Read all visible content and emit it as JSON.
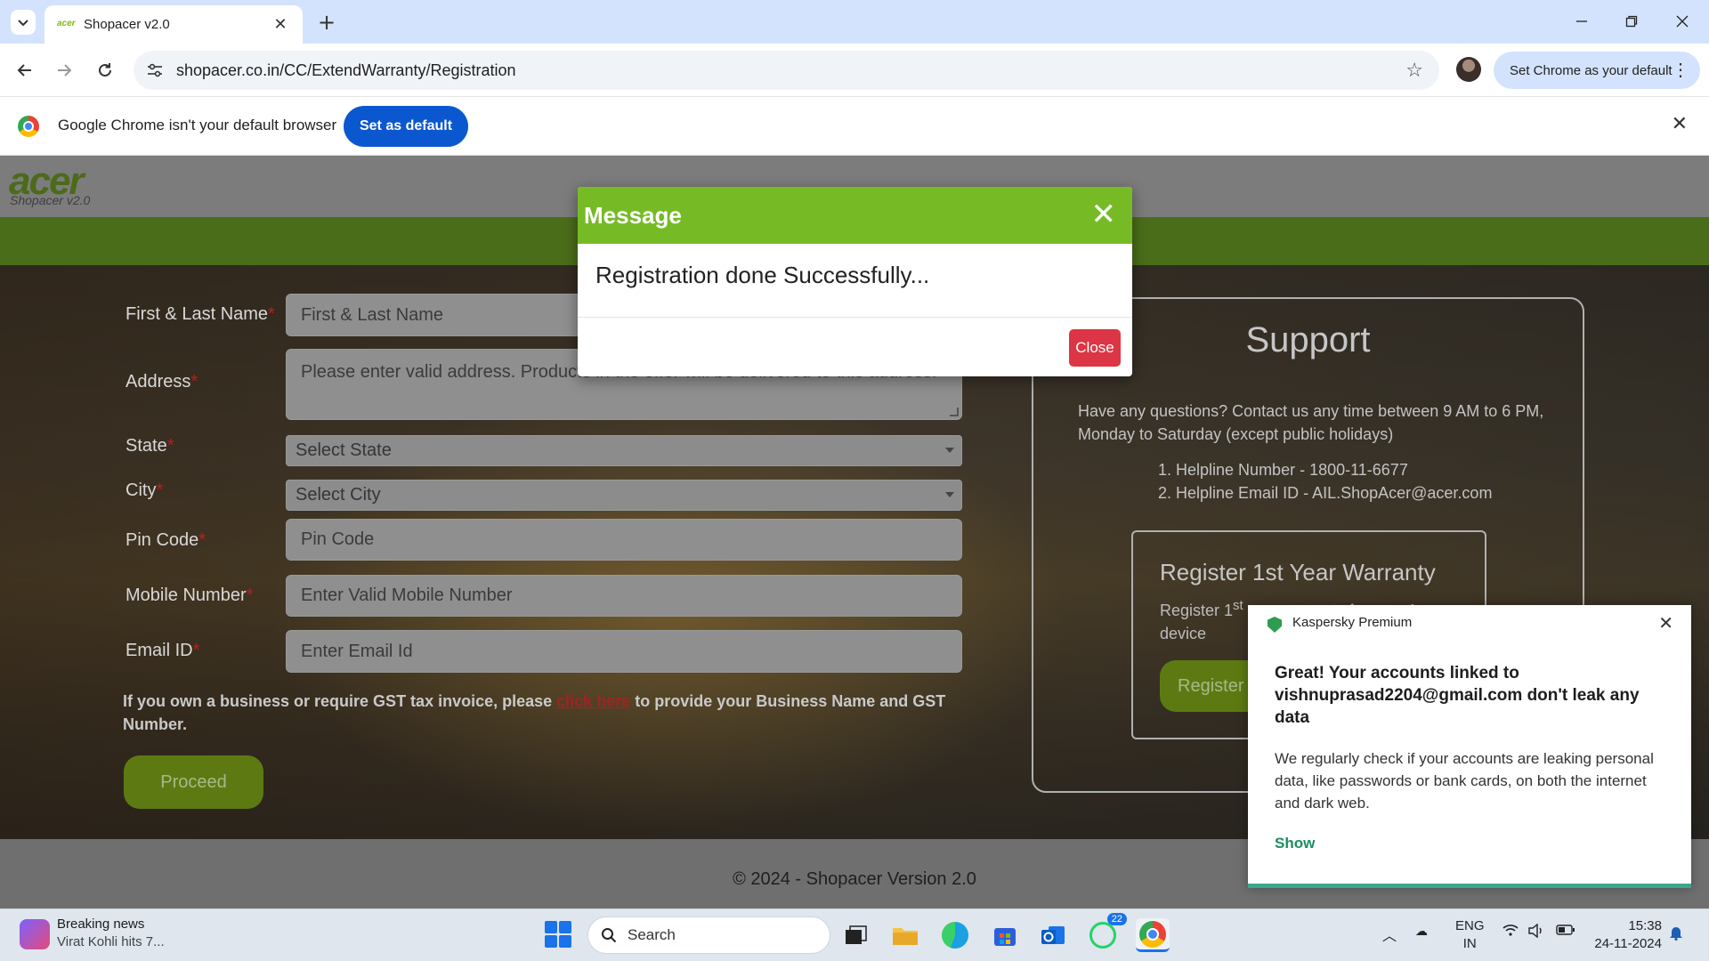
{
  "browser": {
    "tab_title": "Shopacer v2.0",
    "url": "shopacer.co.in/CC/ExtendWarranty/Registration",
    "set_default_chip": "Set Chrome as your default",
    "infobar_text": "Google Chrome isn't your default browser",
    "infobar_button": "Set as default"
  },
  "header": {
    "logo": "acer",
    "logo_sub": "Shopacer v2.0",
    "brand_color": "#76bb26"
  },
  "form": {
    "name_label": "First & Last Name",
    "name_placeholder": "First & Last Name",
    "address_label": "Address",
    "address_placeholder": "Please enter valid address. Products in the offer will be delivered to this address.",
    "state_label": "State",
    "state_value": "Select State",
    "city_label": "City",
    "city_value": "Select City",
    "pin_label": "Pin Code",
    "pin_placeholder": "Pin Code",
    "mobile_label": "Mobile Number",
    "mobile_placeholder": "Enter Valid Mobile Number",
    "email_label": "Email ID",
    "email_placeholder": "Enter Email Id",
    "required_mark": "*",
    "gst_before": "If you own a business or require GST tax invoice, please ",
    "gst_link": "click here",
    "gst_after": " to provide your Business Name and GST Number.",
    "proceed_label": "Proceed"
  },
  "support": {
    "title": "Support",
    "description": "Have any questions? Contact us any time between 9 AM to 6 PM, Monday to Saturday (except public holidays)",
    "items": [
      "1. Helpline Number - 1800-11-6677",
      "2. Helpline Email ID - AIL.ShopAcer@acer.com"
    ],
    "warranty_title": "Register 1st Year Warranty",
    "warranty_desc_a": "Register 1",
    "warranty_desc_sup": "st",
    "warranty_desc_b": " year warranty for your Acer device",
    "warranty_button": "Register"
  },
  "footer": {
    "text": "© 2024 - Shopacer Version 2.0"
  },
  "modal": {
    "title": "Message",
    "close_x": "✕",
    "message": "Registration done Successfully...",
    "close_button": "Close"
  },
  "toast": {
    "app": "Kaspersky Premium",
    "title": "Great! Your accounts linked to vishnuprasad2204@gmail.com don't leak any data",
    "body": "We regularly check if your accounts are leaking personal data, like passwords or bank cards, on both the internet and dark web.",
    "action": "Show"
  },
  "taskbar": {
    "news_title": "Breaking news",
    "news_sub": "Virat Kohli hits 7...",
    "search_label": "Search",
    "whatsapp_badge": "22",
    "lang_1": "ENG",
    "lang_2": "IN",
    "time": "15:38",
    "date": "24-11-2024"
  }
}
